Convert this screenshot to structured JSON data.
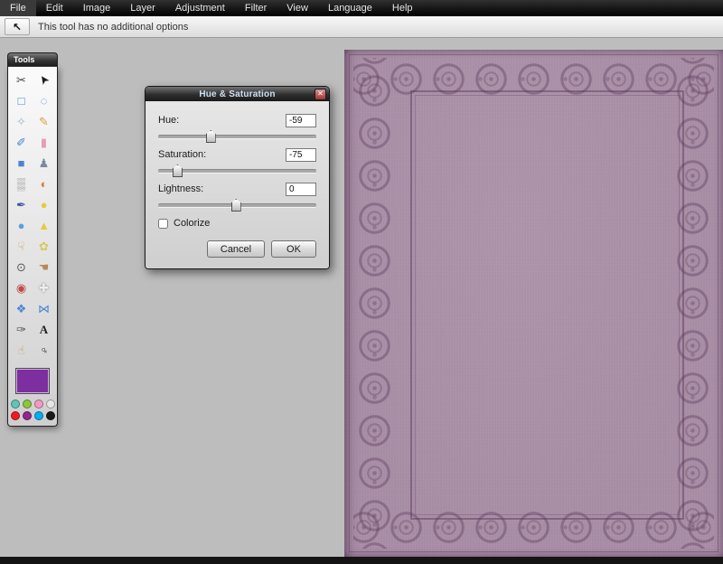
{
  "menu_bar": {
    "items": [
      {
        "label": "File"
      },
      {
        "label": "Edit"
      },
      {
        "label": "Image"
      },
      {
        "label": "Layer"
      },
      {
        "label": "Adjustment"
      },
      {
        "label": "Filter"
      },
      {
        "label": "View"
      },
      {
        "label": "Language"
      },
      {
        "label": "Help"
      }
    ]
  },
  "options_bar": {
    "icon_glyph": "↖",
    "message": "This tool has no additional options"
  },
  "tools_panel": {
    "title": "Tools",
    "primary_color": "#7d2f9f",
    "tools": [
      {
        "name": "crop",
        "glyph": "✂",
        "color": "#444444"
      },
      {
        "name": "move",
        "glyph": "➤",
        "color": "#1a1a1a"
      },
      {
        "name": "marquee",
        "glyph": "□",
        "color": "#4a84d8"
      },
      {
        "name": "lasso",
        "glyph": "◌",
        "color": "#4a84d8"
      },
      {
        "name": "wand",
        "glyph": "✧",
        "color": "#9ab4c8"
      },
      {
        "name": "pencil",
        "glyph": "✎",
        "color": "#d8a03c"
      },
      {
        "name": "brush",
        "glyph": "✐",
        "color": "#4a84d8"
      },
      {
        "name": "eraser",
        "glyph": "▮",
        "color": "#e89bb4"
      },
      {
        "name": "bucket",
        "glyph": "■",
        "color": "#4a84d8"
      },
      {
        "name": "clone-stamp",
        "glyph": "♟",
        "color": "#7a8aa0"
      },
      {
        "name": "gradient",
        "glyph": "▒",
        "color": "#888888"
      },
      {
        "name": "color-replace",
        "glyph": "◐",
        "color": "#d87a3c"
      },
      {
        "name": "pen",
        "glyph": "✒",
        "color": "#3a5a9a"
      },
      {
        "name": "shape",
        "glyph": "●",
        "color": "#e8c840"
      },
      {
        "name": "blur",
        "glyph": "●",
        "color": "#5aa0e0"
      },
      {
        "name": "sharpen",
        "glyph": "▲",
        "color": "#e8c840"
      },
      {
        "name": "smudge",
        "glyph": "☟",
        "color": "#c89b6a"
      },
      {
        "name": "sponge",
        "glyph": "✿",
        "color": "#d8c860"
      },
      {
        "name": "dodge",
        "glyph": "⊙",
        "color": "#555555"
      },
      {
        "name": "burn",
        "glyph": "☚",
        "color": "#b8875a"
      },
      {
        "name": "red-eye",
        "glyph": "◉",
        "color": "#c04848"
      },
      {
        "name": "spot-heal",
        "glyph": "✚",
        "color": "#ededed"
      },
      {
        "name": "bloat",
        "glyph": "❖",
        "color": "#4a84d8"
      },
      {
        "name": "pinch",
        "glyph": "⋈",
        "color": "#4a84d8"
      },
      {
        "name": "colorpicker",
        "glyph": "✑",
        "color": "#555555"
      },
      {
        "name": "type",
        "glyph": "A",
        "color": "#222222"
      },
      {
        "name": "hand",
        "glyph": "☝",
        "color": "#c89b6a"
      },
      {
        "name": "zoom",
        "glyph": "♀",
        "color": "#333333"
      }
    ],
    "swatches": [
      [
        "#62c4b8",
        "#8cc63f",
        "#f49ac1",
        "#e6e6e6"
      ],
      [
        "#ed1c24",
        "#92278f",
        "#00aeef",
        "#1a1a1a"
      ]
    ]
  },
  "dialog": {
    "title": "Hue & Saturation",
    "close_glyph": "✕",
    "sliders": [
      {
        "label": "Hue:",
        "value": "-59",
        "thumb_pct": 33
      },
      {
        "label": "Saturation:",
        "value": "-75",
        "thumb_pct": 12
      },
      {
        "label": "Lightness:",
        "value": "0",
        "thumb_pct": 49
      }
    ],
    "colorize_label": "Colorize",
    "colorize_checked": false,
    "cancel_label": "Cancel",
    "ok_label": "OK"
  },
  "canvas": {
    "cover_base": "#a98ea6",
    "cover_accent": "#5c3a5c"
  }
}
